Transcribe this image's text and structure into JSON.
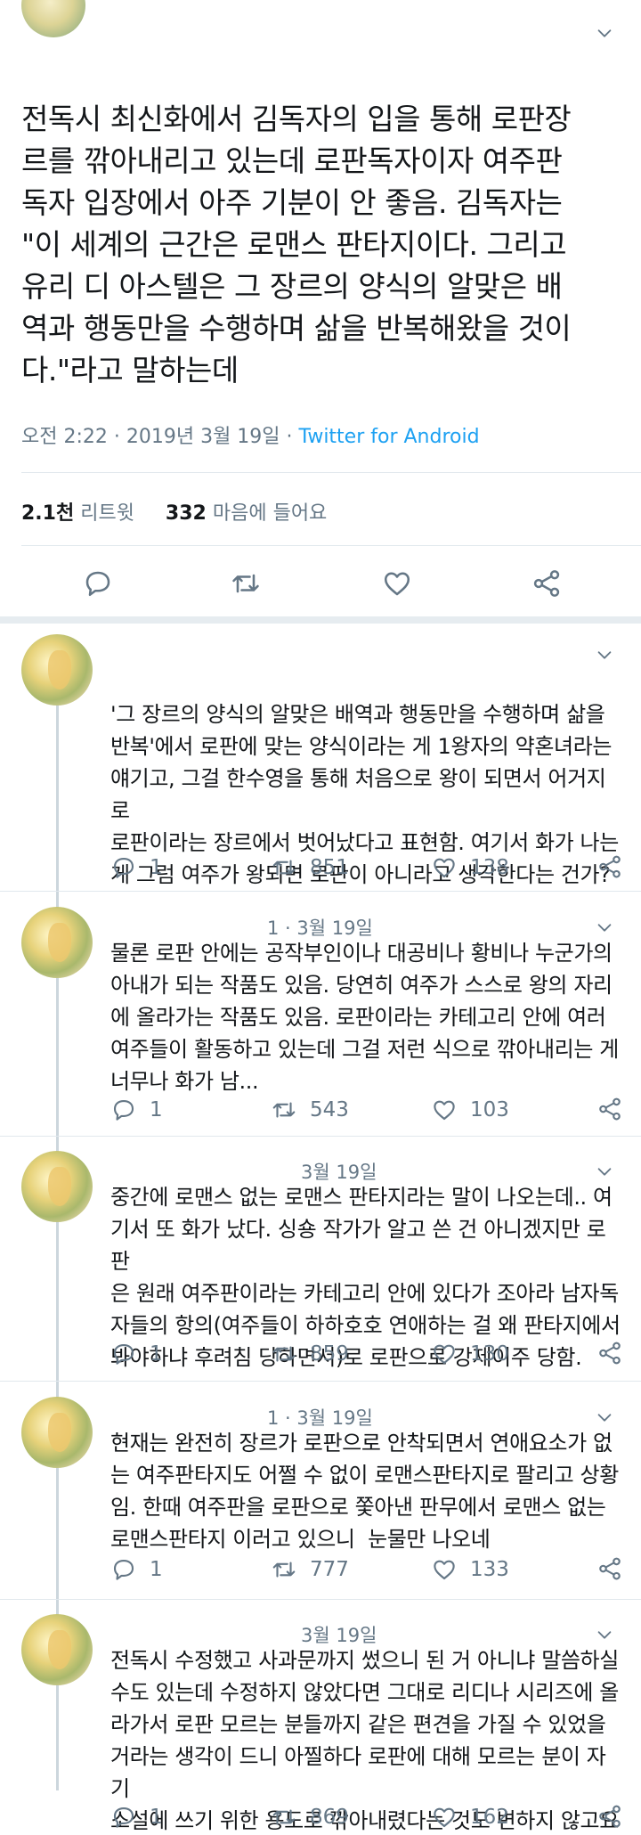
{
  "main_tweet": {
    "text": "전독시 최신화에서 김독자의 입을 통해 로판장\n르를 깎아내리고 있는데 로판독자이자 여주판\n독자 입장에서 아주 기분이 안 좋음. 김독자는\n\"이 세계의 근간은 로맨스 판타지이다. 그리고\n유리 디 아스텔은 그 장르의 양식의 알맞은 배\n역과 행동만을 수행하며 삶을 반복해왔을 것이\n다.\"라고 말하는데",
    "time": "오전 2:22 · 2019년 3월 19일 · ",
    "source": "Twitter for Android",
    "retweet_count": "2.1천",
    "retweet_label": "리트윗",
    "like_count": "332",
    "like_label": "마음에 들어요"
  },
  "replies": [
    {
      "header": "",
      "text": "'그 장르의 양식의 알맞은 배역과 행동만을 수행하며 삶을\n반복'에서 로판에 맞는 양식이라는 게 1왕자의 약혼녀라는\n얘기고, 그걸 한수영을 통해 처음으로 왕이 되면서 어거지로\n로판이라는 장르에서 벗어났다고 표현함. 여기서 화가 나는\n게 그럼 여주가 왕되면 로판이 아니라고 생각한다는 건가?",
      "replies": "1",
      "retweets": "851",
      "likes": "138"
    },
    {
      "header": "1 · 3월 19일",
      "text": "물론 로판 안에는 공작부인이나 대공비나 황비나 누군가의\n아내가 되는 작품도 있음. 당연히 여주가 스스로 왕의 자리\n에 올라가는 작품도 있음. 로판이라는 카테고리 안에 여러\n여주들이 활동하고 있는데 그걸 저런 식으로 깎아내리는 게\n너무나 화가 남...",
      "replies": "1",
      "retweets": "543",
      "likes": "103"
    },
    {
      "header": "3월 19일",
      "text": "중간에 로맨스 없는 로맨스 판타지라는 말이 나오는데.. 여\n기서 또 화가 났다. 싱숑 작가가 알고 쓴 건 아니겠지만 로판\n은 원래 여주판이라는 카테고리 안에 있다가 조아라 남자독\n자들의 항의(여주들이 하하호호 연애하는 걸 왜 판타지에서\n봐야하냐 후려침 당하면서)로 로판으로 강제이주 당함.",
      "replies": "1",
      "retweets": "859",
      "likes": "130"
    },
    {
      "header": "1 · 3월 19일",
      "text": "현재는 완전히 장르가 로판으로 안착되면서 연애요소가 없\n는 여주판타지도 어쩔 수 없이 로맨스판타지로 팔리고 상황\n임. 한때 여주판을 로판으로 쫓아낸 판무에서 로맨스 없는\n로맨스판타지 이러고 있으니  눈물만 나오네",
      "replies": "1",
      "retweets": "777",
      "likes": "133"
    },
    {
      "header": "3월 19일",
      "text": "전독시 수정했고 사과문까지 썼으니 된 거 아니냐 말씀하실\n수도 있는데 수정하지 않았다면 그대로 리디나 시리즈에 올\n라가서 로판 모르는 분들까지 같은 편견을 가질 수 있었을\n거라는 생각이 드니 아찔하다 로판에 대해 모르는 분이 자기\n소설에 쓰기 위한 용도로 깎아내렸다는 것도 변하지 않고요",
      "replies": "1",
      "retweets": "869",
      "likes": "162"
    }
  ],
  "icons": {
    "reply": "reply-icon",
    "retweet": "retweet-icon",
    "like": "heart-icon",
    "share": "share-icon",
    "caret": "chevron-down-icon"
  },
  "colors": {
    "text": "#14171a",
    "muted": "#657786",
    "link": "#1da1f2",
    "divider": "#e1e8ed"
  }
}
